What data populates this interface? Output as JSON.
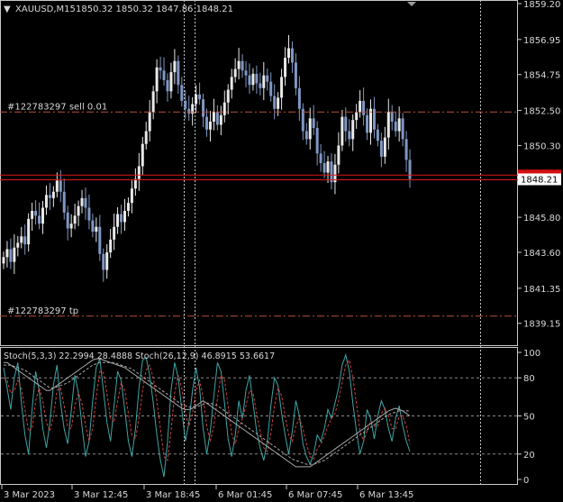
{
  "chart_data": [
    {
      "type": "candlestick",
      "symbol_header": "XAUUSD,M15",
      "ohlc_text": "1850.32 1850.32 1847.86 1848.21",
      "last_price": 1848.21,
      "last_price_label": "1848.21",
      "ylim": [
        1838.4,
        1859.2
      ],
      "y_ticks": [
        "1859.20",
        "1856.95",
        "1854.75",
        "1852.50",
        "1850.30",
        "1848.05",
        "1845.80",
        "1843.60",
        "1841.35",
        "1839.15"
      ],
      "order_lines": [
        {
          "label": "#122783297 sell 0.01",
          "price": 1852.4,
          "color": "#b5533b"
        },
        {
          "label": "#122783297 tp",
          "price": 1839.6,
          "color": "#b5533b"
        }
      ],
      "red_lines": [
        1848.45,
        1848.15
      ],
      "closes": [
        1843.3,
        1843.8,
        1843.0,
        1843.9,
        1844.2,
        1844.6,
        1844.1,
        1845.7,
        1846.2,
        1845.9,
        1845.4,
        1846.4,
        1847.2,
        1847.0,
        1847.4,
        1848.1,
        1847.4,
        1846.1,
        1845.1,
        1845.4,
        1845.9,
        1846.5,
        1847.0,
        1846.4,
        1845.6,
        1844.9,
        1845.2,
        1843.5,
        1842.5,
        1843.6,
        1844.4,
        1845.2,
        1846.0,
        1845.5,
        1846.2,
        1846.7,
        1847.6,
        1848.2,
        1849.0,
        1850.4,
        1851.2,
        1852.4,
        1853.7,
        1855.2,
        1855.0,
        1854.4,
        1853.7,
        1854.9,
        1855.6,
        1854.1,
        1853.1,
        1852.6,
        1852.3,
        1852.9,
        1853.5,
        1853.2,
        1852.1,
        1851.3,
        1851.8,
        1852.4,
        1851.6,
        1852.2,
        1853.0,
        1853.8,
        1854.6,
        1855.1,
        1855.6,
        1855.0,
        1854.7,
        1854.1,
        1854.8,
        1854.2,
        1853.9,
        1854.7,
        1854.3,
        1853.4,
        1852.6,
        1853.3,
        1854.6,
        1855.8,
        1856.4,
        1855.5,
        1853.9,
        1852.6,
        1851.2,
        1850.7,
        1852.0,
        1851.4,
        1849.8,
        1849.2,
        1848.6,
        1849.3,
        1848.0,
        1849.1,
        1850.3,
        1852.1,
        1851.2,
        1850.7,
        1851.9,
        1852.4,
        1853.1,
        1852.2,
        1851.1,
        1852.6,
        1851.3,
        1850.6,
        1849.6,
        1850.8,
        1852.4,
        1851.8,
        1851.2,
        1852.0,
        1850.7,
        1849.4,
        1848.2
      ]
    },
    {
      "type": "line",
      "header": "Stoch(5,3,3) 22.2994 28.4888   Stoch(26,12,9) 46.8915 53.6617",
      "ylim": [
        0,
        100
      ],
      "y_ticks": [
        "100",
        "80",
        "50",
        "20",
        "0"
      ],
      "levels": [
        80,
        50,
        20
      ],
      "series": [
        {
          "name": "Stoch(5,3,3)",
          "color": "#3fa6a6",
          "style": "solid",
          "values": [
            88,
            72,
            55,
            80,
            92,
            60,
            35,
            20,
            55,
            85,
            70,
            40,
            25,
            45,
            75,
            90,
            60,
            40,
            28,
            55,
            82,
            68,
            42,
            18,
            30,
            62,
            88,
            95,
            70,
            45,
            30,
            58,
            85,
            78,
            55,
            30,
            18,
            40,
            72,
            94,
            96,
            82,
            60,
            35,
            15,
            2,
            30,
            70,
            92,
            80,
            55,
            30,
            45,
            70,
            88,
            72,
            40,
            20,
            38,
            66,
            92,
            85,
            60,
            32,
            18,
            35,
            62,
            48,
            70,
            82,
            60,
            38,
            25,
            15,
            30,
            58,
            80,
            74,
            52,
            35,
            20,
            38,
            62,
            50,
            28,
            18,
            12,
            20,
            35,
            30,
            40,
            55,
            48,
            60,
            72,
            90,
            98,
            85,
            60,
            38,
            20,
            30,
            55,
            48,
            32,
            50,
            62,
            55,
            40,
            30,
            48,
            58,
            42,
            30,
            22
          ]
        },
        {
          "name": "Stoch(5,3,3) signal",
          "color": "#d04040",
          "style": "dashed",
          "values": [
            80,
            78,
            68,
            70,
            78,
            72,
            55,
            38,
            40,
            62,
            72,
            62,
            45,
            38,
            50,
            70,
            72,
            58,
            42,
            40,
            58,
            68,
            60,
            42,
            30,
            40,
            65,
            85,
            84,
            68,
            48,
            45,
            62,
            76,
            70,
            52,
            35,
            32,
            48,
            70,
            86,
            90,
            80,
            62,
            40,
            18,
            15,
            38,
            68,
            82,
            72,
            52,
            42,
            52,
            70,
            78,
            65,
            42,
            30,
            42,
            64,
            82,
            78,
            58,
            36,
            28,
            40,
            48,
            58,
            70,
            68,
            52,
            38,
            25,
            22,
            36,
            58,
            72,
            66,
            50,
            35,
            30,
            42,
            48,
            40,
            28,
            18,
            16,
            24,
            28,
            34,
            42,
            48,
            52,
            62,
            76,
            90,
            94,
            80,
            60,
            38,
            30,
            38,
            46,
            42,
            42,
            52,
            56,
            50,
            40,
            40,
            50,
            50,
            42,
            28
          ]
        },
        {
          "name": "Stoch(26,12,9)",
          "color": "#a8a8a8",
          "style": "solid",
          "values": [
            92,
            92,
            90,
            88,
            86,
            84,
            82,
            80,
            78,
            76,
            74,
            72,
            70,
            70,
            72,
            74,
            76,
            78,
            80,
            82,
            84,
            86,
            88,
            90,
            92,
            94,
            95,
            95,
            94,
            93,
            92,
            91,
            90,
            89,
            88,
            86,
            84,
            82,
            80,
            78,
            76,
            74,
            72,
            70,
            68,
            66,
            64,
            62,
            60,
            58,
            56,
            55,
            55,
            56,
            58,
            60,
            62,
            60,
            58,
            56,
            54,
            52,
            50,
            48,
            46,
            44,
            42,
            40,
            38,
            36,
            34,
            32,
            30,
            28,
            26,
            24,
            22,
            20,
            18,
            16,
            14,
            12,
            10,
            10,
            10,
            10,
            10,
            12,
            14,
            16,
            18,
            20,
            22,
            24,
            26,
            28,
            30,
            32,
            34,
            36,
            38,
            40,
            42,
            44,
            46,
            48,
            50,
            52,
            54,
            55,
            56,
            55,
            54,
            52,
            50
          ]
        },
        {
          "name": "Stoch(26,12,9) signal",
          "color": "#a8a8a8",
          "style": "dashed",
          "values": [
            90,
            90,
            90,
            89,
            88,
            87,
            86,
            84,
            82,
            80,
            78,
            76,
            74,
            72,
            72,
            73,
            74,
            75,
            76,
            78,
            80,
            82,
            84,
            86,
            88,
            90,
            91,
            92,
            92,
            92,
            92,
            92,
            91,
            90,
            89,
            88,
            87,
            85,
            83,
            81,
            79,
            77,
            75,
            73,
            71,
            69,
            67,
            65,
            63,
            61,
            59,
            58,
            57,
            57,
            57,
            58,
            59,
            60,
            60,
            59,
            58,
            56,
            54,
            52,
            50,
            48,
            46,
            44,
            42,
            40,
            38,
            36,
            34,
            32,
            30,
            28,
            26,
            24,
            22,
            20,
            18,
            16,
            15,
            14,
            13,
            12,
            12,
            12,
            13,
            14,
            15,
            17,
            19,
            21,
            23,
            25,
            27,
            29,
            31,
            33,
            35,
            37,
            39,
            41,
            43,
            45,
            47,
            49,
            51,
            52,
            53,
            54,
            54,
            54,
            54
          ]
        }
      ]
    }
  ],
  "x_labels": [
    "3 Mar 2023",
    "3 Mar 12:45",
    "3 Mar 18:45",
    "6 Mar 01:45",
    "6 Mar 07:45",
    "6 Mar 13:45"
  ]
}
